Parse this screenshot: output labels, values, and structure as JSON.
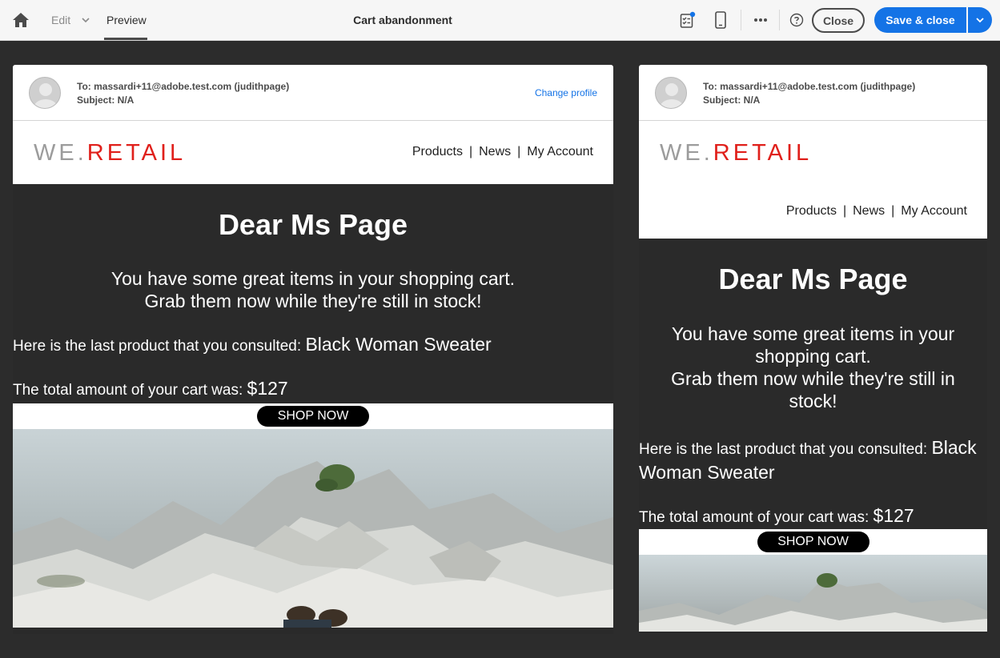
{
  "topbar": {
    "edit_label": "Edit",
    "preview_label": "Preview",
    "title": "Cart abandonment",
    "close_label": "Close",
    "save_label": "Save & close",
    "accent": "#1473e6"
  },
  "recipient": {
    "to": "To: massardi+11@adobe.test.com (judithpage)",
    "subject": "Subject: N/A",
    "change_profile": "Change profile"
  },
  "email": {
    "logo_we": "WE.",
    "logo_retail": "RETAIL",
    "nav": [
      "Products",
      "News",
      "My Account"
    ],
    "nav_separator": "|",
    "greeting": "Dear  Ms Page",
    "lead_line1": "You have some great items in your shopping cart.",
    "lead_line2": "Grab them now while they're still in stock!",
    "product_prefix": "Here is the last product that you consulted: ",
    "product_name": "Black Woman Sweater",
    "total_prefix": "The total amount of your cart was: ",
    "total_value": "$127",
    "cta": "SHOP NOW",
    "brand_red": "#e0201b"
  }
}
